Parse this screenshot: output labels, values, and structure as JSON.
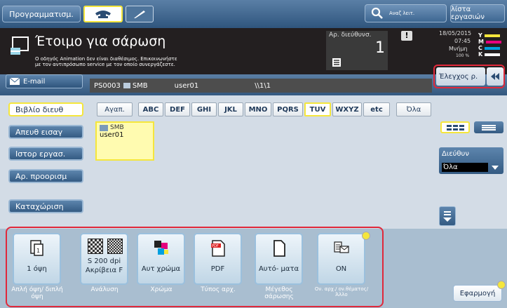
{
  "topbar": {
    "program_label": "Προγραμματισμ.",
    "search_label": "Αναζ λειτ.",
    "job_list_label": "λίστα εργασιών"
  },
  "status": {
    "title": "Έτοιμο για σάρωση",
    "message_line1": "Ο οδηγός Animation δεν είναι διαθέσιμος. Επικοινωνήστε",
    "message_line2": "με τον αντιπρόσωπο service με τον οποίο συνεργάζεστε.",
    "jobs_label": "Αρ. διεύθυνσ.",
    "jobs_count": "1",
    "date": "18/05/2015",
    "time": "07:45",
    "memory_label": "Μνήμη",
    "memory_value": "100 %",
    "toner": [
      "Y",
      "M",
      "C",
      "K"
    ]
  },
  "strip": {
    "email_tab": "E-mail",
    "path_id": "PS0003",
    "path_type": "SMB",
    "path_user": "user01",
    "path_folder": "\\\\1\\1",
    "check_button": "Έλεγχος ρ."
  },
  "left_menu": [
    "Βιβλίο διευθ",
    "Απευθ εισαγ",
    "Ιστορ εργασ.",
    "Αρ. προορισμ",
    "Καταχώριση"
  ],
  "index_tabs": [
    "Αγαπ.",
    "ABC",
    "DEF",
    "GHI",
    "JKL",
    "MNO",
    "PQRS",
    "TUV",
    "WXYZ",
    "etc",
    "Όλα"
  ],
  "address_entry": {
    "type": "SMB",
    "name": "user01"
  },
  "right_panel": {
    "address_label": "Διεύθυν",
    "address_value": "Όλα"
  },
  "settings": [
    {
      "value": "1 όψη",
      "label": "Απλή όψη/ διπλή όψη",
      "icon": "simplex-icon"
    },
    {
      "value": "S 200 dpi Ακρίβεια F",
      "label": "Ανάλυση",
      "icon": "resolution-icon"
    },
    {
      "value": "Αυτ χρώμα",
      "label": "Χρώμα",
      "icon": "color-icon"
    },
    {
      "value": "PDF",
      "label": "Τύπος αρχ.",
      "icon": "pdf-icon"
    },
    {
      "value": "Αυτό- ματα",
      "label": "Μέγεθος σάρωσης",
      "icon": "page-icon"
    },
    {
      "value": "ON",
      "label": "Ον. αρχ./ ον.θέματος/ Άλλο",
      "icon": "mail-icon"
    }
  ],
  "apply_button": "Εφαρμογή",
  "colors": {
    "highlight": "#e0283a",
    "accent_yellow": "#f5e63c"
  }
}
